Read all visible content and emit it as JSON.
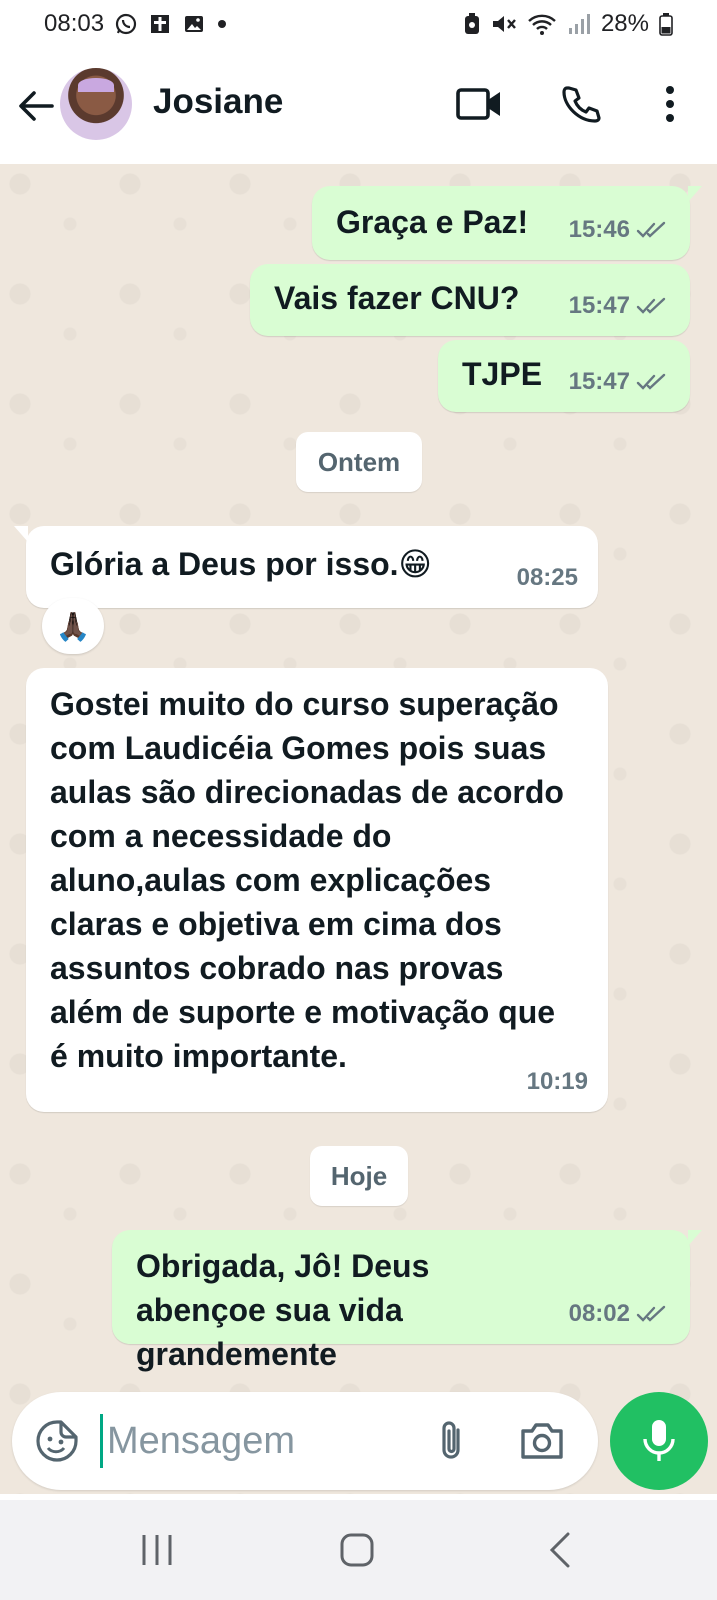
{
  "status_bar": {
    "time": "08:03",
    "battery": "28%",
    "icons": [
      "whatsapp-icon",
      "tool-icon",
      "image-icon",
      "dot-icon",
      "battery-saver-icon",
      "mute-icon",
      "wifi-icon",
      "signal-icon",
      "battery-icon"
    ]
  },
  "header": {
    "contact_name": "Josiane",
    "icons": [
      "back-arrow-icon",
      "avatar",
      "video-call-icon",
      "phone-icon",
      "more-vert-icon"
    ]
  },
  "colors": {
    "outgoing_bubble": "#d9fdd3",
    "incoming_bubble": "#ffffff",
    "chat_background": "#efe7dd",
    "mic_button": "#21c063",
    "tick_color": "#667781"
  },
  "messages": [
    {
      "direction": "out",
      "text": "Graça e Paz!",
      "time": "15:46",
      "status": "read"
    },
    {
      "direction": "out",
      "text": "Vais fazer CNU?",
      "time": "15:47",
      "status": "read"
    },
    {
      "direction": "out",
      "text": "TJPE",
      "time": "15:47",
      "status": "read"
    },
    {
      "direction": "in",
      "text": "Glória a Deus por isso.😁",
      "time": "08:25",
      "reaction": "🙏🏿"
    },
    {
      "direction": "in",
      "text": "Gostei muito do curso superação com Laudicéia Gomes pois suas aulas são direcionadas de acordo com a necessidade do aluno,aulas com explicações claras e objetiva em cima dos assuntos cobrado nas provas além de suporte e motivação que é muito importante.",
      "time": "10:19"
    },
    {
      "direction": "out",
      "text": "Obrigada, Jô! Deus abençoe sua vida grandemente",
      "time": "08:02",
      "status": "read"
    }
  ],
  "date_dividers": {
    "yesterday": "Ontem",
    "today": "Hoje"
  },
  "composer": {
    "placeholder": "Mensagem",
    "icons": [
      "sticker-icon",
      "attach-icon",
      "camera-icon",
      "mic-icon"
    ]
  },
  "nav_bar": {
    "icons": [
      "recent-apps-icon",
      "home-icon",
      "back-icon"
    ]
  }
}
